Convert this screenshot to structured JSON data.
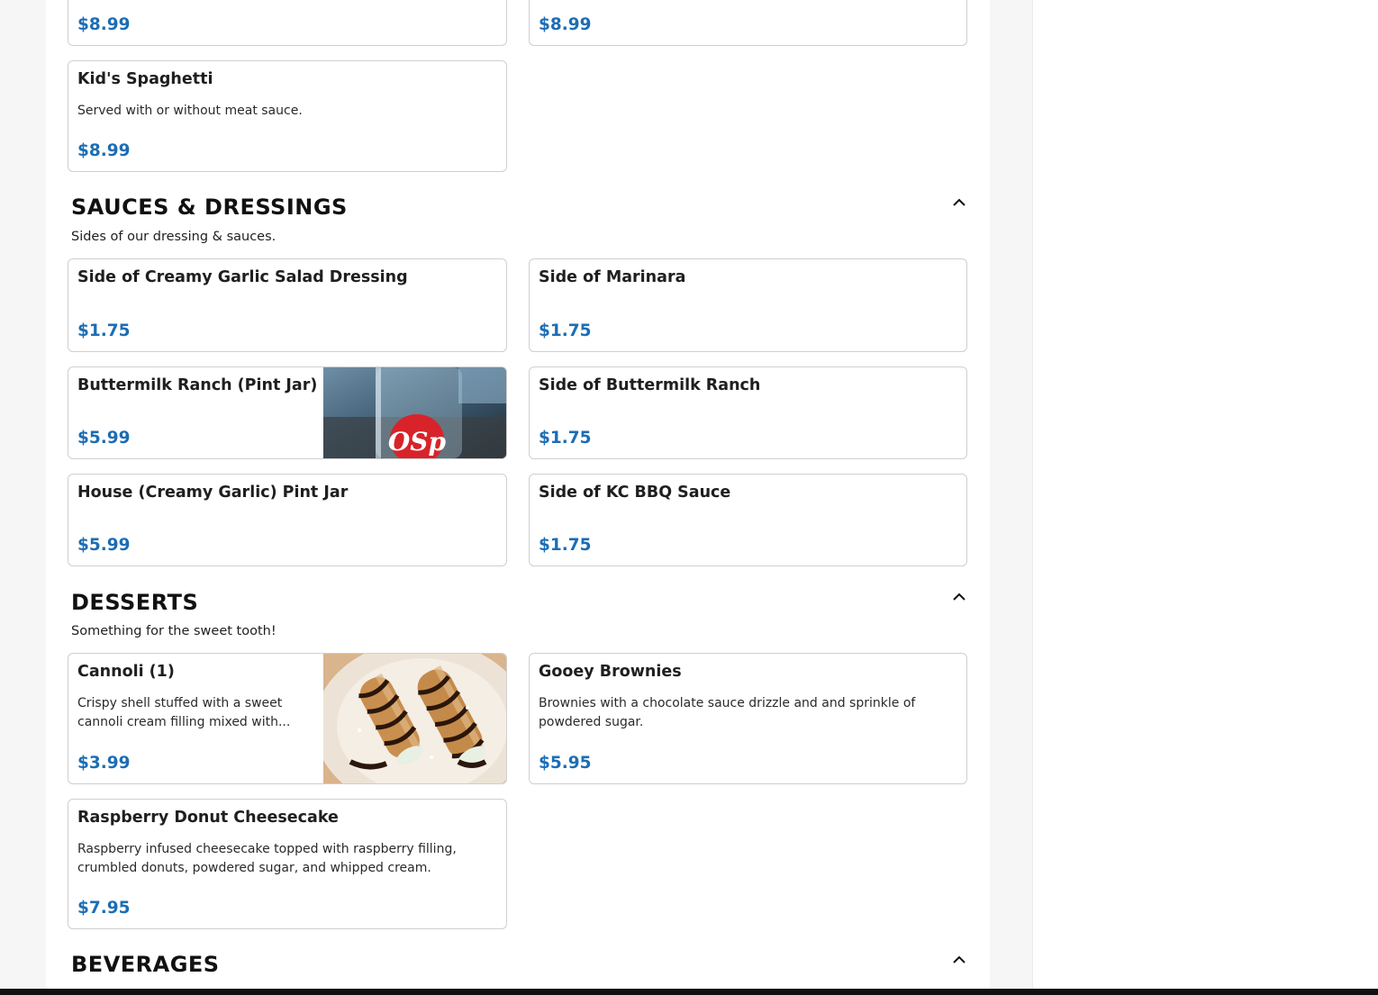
{
  "top_prices": [
    "$8.99",
    "$8.99"
  ],
  "kids": {
    "spaghetti": {
      "name": "Kid's Spaghetti",
      "desc": "Served with or without meat sauce.",
      "price": "$8.99"
    }
  },
  "sauces": {
    "title": "SAUCES & DRESSINGS",
    "subtitle": "Sides of our dressing & sauces.",
    "items": [
      {
        "name": "Side of Creamy Garlic Salad Dressing",
        "price": "$1.75"
      },
      {
        "name": "Side of Marinara",
        "price": "$1.75"
      },
      {
        "name": "Buttermilk Ranch (Pint Jar)",
        "price": "$5.99",
        "image": "ranch-jar-photo",
        "jar_text": "OSp"
      },
      {
        "name": "Side of Buttermilk Ranch",
        "price": "$1.75"
      },
      {
        "name": "House (Creamy Garlic) Pint Jar",
        "price": "$5.99"
      },
      {
        "name": "Side of KC BBQ Sauce",
        "price": "$1.75"
      }
    ]
  },
  "desserts": {
    "title": "DESSERTS",
    "subtitle": "Something for the sweet tooth!",
    "items": [
      {
        "name": "Cannoli (1)",
        "desc": "Crispy shell stuffed with a sweet cannoli cream filling mixed with...",
        "price": "$3.99",
        "image": "cannoli-photo"
      },
      {
        "name": "Gooey Brownies",
        "desc": "Brownies with a chocolate sauce drizzle and and sprinkle of powdered sugar.",
        "price": "$5.95"
      },
      {
        "name": "Raspberry Donut Cheesecake",
        "desc": "Raspberry infused cheesecake topped with raspberry filling, crumbled donuts, powdered sugar, and whipped cream.",
        "price": "$7.95"
      }
    ]
  },
  "beverages": {
    "title": "BEVERAGES"
  },
  "icons": {
    "collapse": "chevron-up-icon"
  },
  "colors": {
    "price": "#1c6db5",
    "card_border": "#cfcfcf",
    "background": "#f6f6f6"
  }
}
